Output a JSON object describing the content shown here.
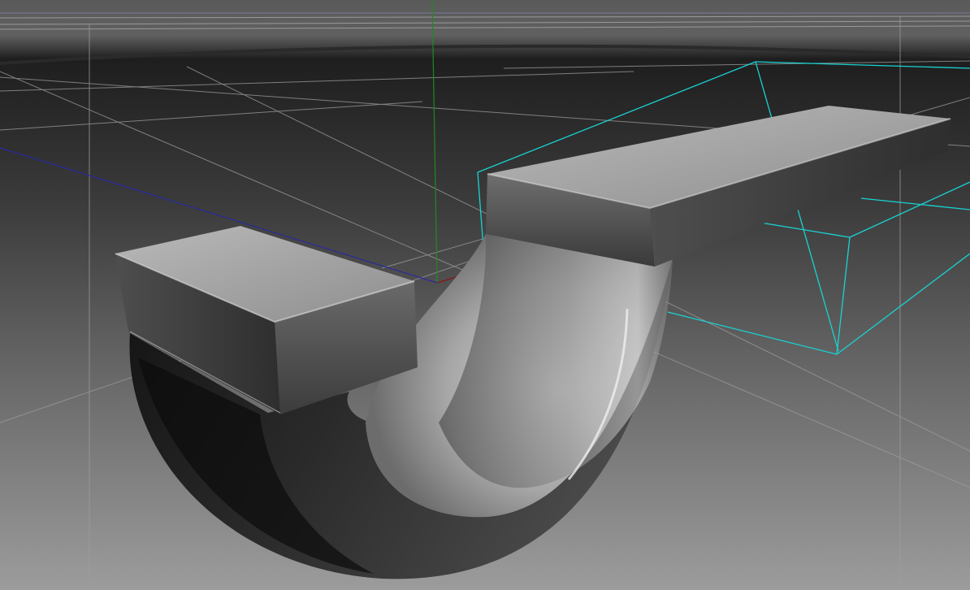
{
  "viewport": {
    "kind": "3D perspective viewport",
    "background_colors": {
      "top": "#5c5c5c",
      "horizon": "#1c1c1c",
      "bottom": "#9a9a9a"
    },
    "grid": {
      "visible": true,
      "line_color": "#a8a8a8",
      "x_axis_color": "#8a1818",
      "y_axis_color": "#1f8a1f",
      "z_axis_color": "#1c1c8a"
    },
    "selection_color": "#19d3d3",
    "objects": [
      {
        "name": "left-block",
        "type": "box",
        "selected": false
      },
      {
        "name": "u-bend",
        "type": "curved pipe",
        "selected": false
      },
      {
        "name": "long-bar",
        "type": "box",
        "selected": true
      }
    ]
  }
}
